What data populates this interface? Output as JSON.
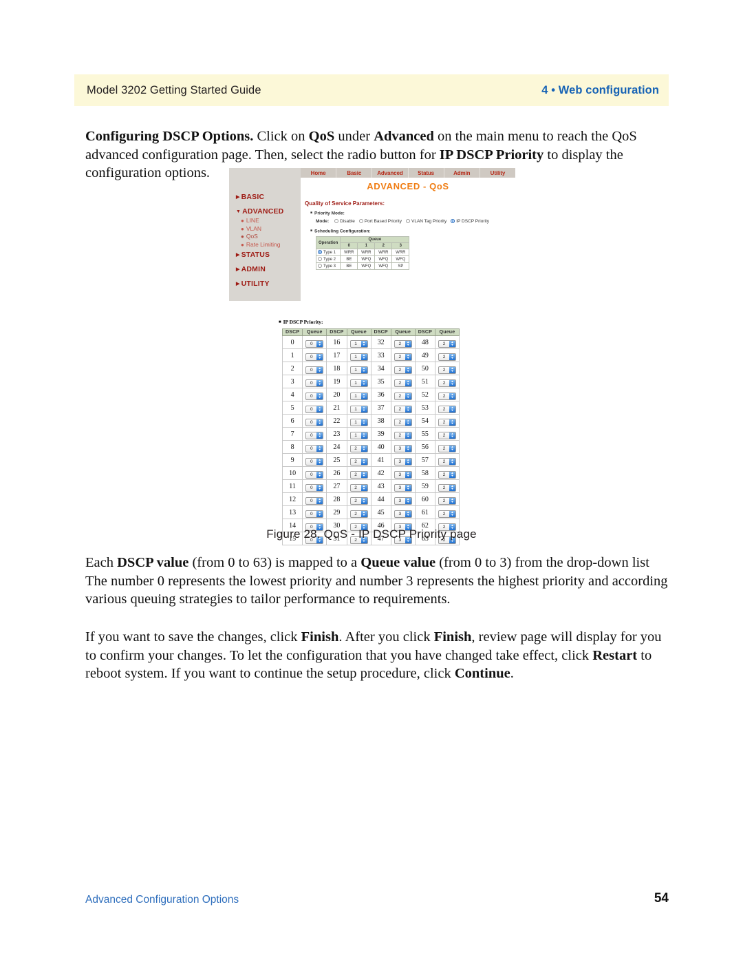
{
  "page": {
    "running_head_left": "Model 3202 Getting Started Guide",
    "running_head_right": "4 • Web configuration",
    "footer_left": "Advanced Configuration Options",
    "footer_page_number": "54",
    "header_band_color": "#fcf8d8",
    "accent_blue": "#1763b5"
  },
  "paragraphs": {
    "intro_bold_lead": "Configuring DSCP Options.",
    "intro_rest": " Click on QoS under Advanced on the main menu to reach the QoS advanced configuration page. Then, select the radio button for IP DSCP Priority to display the configuration options.",
    "each_dscp": "Each DSCP value (from 0 to 63) is mapped to a Queue value (from 0 to 3) from the drop-down list The number 0 represents the lowest priority and number 3 represents the highest priority and according various queuing strategies to tailor performance to requirements.",
    "finish": "If you want to save the changes, click Finish. After you click Finish, review page will display for you to confirm your changes. To let the configuration that you have changed take effect, click Restart to reboot system. If you want to continue the setup procedure, click Continue."
  },
  "caption": "Figure 28. QoS - IP DSCP Priority page",
  "screenshot": {
    "nav_items": [
      "Home",
      "Basic",
      "Advanced",
      "Status",
      "Admin",
      "Utility"
    ],
    "nav_text_color": "#b52a18",
    "page_title": "ADVANCED - QoS",
    "page_title_color": "#f07d13",
    "sidebar": [
      {
        "label": "BASIC",
        "type": "head"
      },
      {
        "label": "ADVANCED",
        "type": "head",
        "expanded": true
      },
      {
        "label": "LINE",
        "type": "sub"
      },
      {
        "label": "VLAN",
        "type": "sub"
      },
      {
        "label": "QoS",
        "type": "sub",
        "current": true
      },
      {
        "label": "Rate Limiting",
        "type": "sub"
      },
      {
        "label": "STATUS",
        "type": "head"
      },
      {
        "label": "ADMIN",
        "type": "head"
      },
      {
        "label": "UTILITY",
        "type": "head"
      }
    ],
    "section_title": "Quality of Service Parameters:",
    "priority_mode_label": "Priority Mode:",
    "mode_label": "Mode:",
    "mode_options": [
      {
        "label": "Disable",
        "selected": false
      },
      {
        "label": "Port Based Priority",
        "selected": false
      },
      {
        "label": "VLAN Tag Priority",
        "selected": false
      },
      {
        "label": "IP DSCP Priority",
        "selected": true
      }
    ],
    "scheduling_label": "Scheduling Configuration:",
    "scheduling_table": {
      "operation_header": "Operation",
      "queue_header": "Queue",
      "queue_columns": [
        "0",
        "1",
        "2",
        "3"
      ],
      "rows": [
        {
          "name": "Type 1",
          "selected": true,
          "values": [
            "WRR",
            "WRR",
            "WRR",
            "WRR"
          ]
        },
        {
          "name": "Type 2",
          "selected": false,
          "values": [
            "BE",
            "WFQ",
            "WFQ",
            "WFQ"
          ]
        },
        {
          "name": "Type 3",
          "selected": false,
          "values": [
            "BE",
            "WFQ",
            "WFQ",
            "SP"
          ]
        }
      ]
    },
    "dscp_label": "IP DSCP Priority:",
    "dscp_table": {
      "headers": [
        "DSCP",
        "Queue",
        "DSCP",
        "Queue",
        "DSCP",
        "Queue",
        "DSCP",
        "Queue"
      ],
      "rows": [
        [
          "0",
          "0",
          "16",
          "1",
          "32",
          "2",
          "48",
          "2"
        ],
        [
          "1",
          "0",
          "17",
          "1",
          "33",
          "2",
          "49",
          "2"
        ],
        [
          "2",
          "0",
          "18",
          "1",
          "34",
          "2",
          "50",
          "2"
        ],
        [
          "3",
          "0",
          "19",
          "1",
          "35",
          "2",
          "51",
          "2"
        ],
        [
          "4",
          "0",
          "20",
          "1",
          "36",
          "2",
          "52",
          "2"
        ],
        [
          "5",
          "0",
          "21",
          "1",
          "37",
          "2",
          "53",
          "2"
        ],
        [
          "6",
          "0",
          "22",
          "1",
          "38",
          "2",
          "54",
          "2"
        ],
        [
          "7",
          "0",
          "23",
          "1",
          "39",
          "2",
          "55",
          "2"
        ],
        [
          "8",
          "0",
          "24",
          "2",
          "40",
          "3",
          "56",
          "2"
        ],
        [
          "9",
          "0",
          "25",
          "2",
          "41",
          "3",
          "57",
          "2"
        ],
        [
          "10",
          "0",
          "26",
          "2",
          "42",
          "3",
          "58",
          "2"
        ],
        [
          "11",
          "0",
          "27",
          "2",
          "43",
          "3",
          "59",
          "2"
        ],
        [
          "12",
          "0",
          "28",
          "2",
          "44",
          "3",
          "60",
          "2"
        ],
        [
          "13",
          "0",
          "29",
          "2",
          "45",
          "3",
          "61",
          "2"
        ],
        [
          "14",
          "0",
          "30",
          "2",
          "46",
          "3",
          "62",
          "2"
        ],
        [
          "15",
          "0",
          "31",
          "2",
          "47",
          "3",
          "63",
          "2"
        ]
      ]
    }
  }
}
